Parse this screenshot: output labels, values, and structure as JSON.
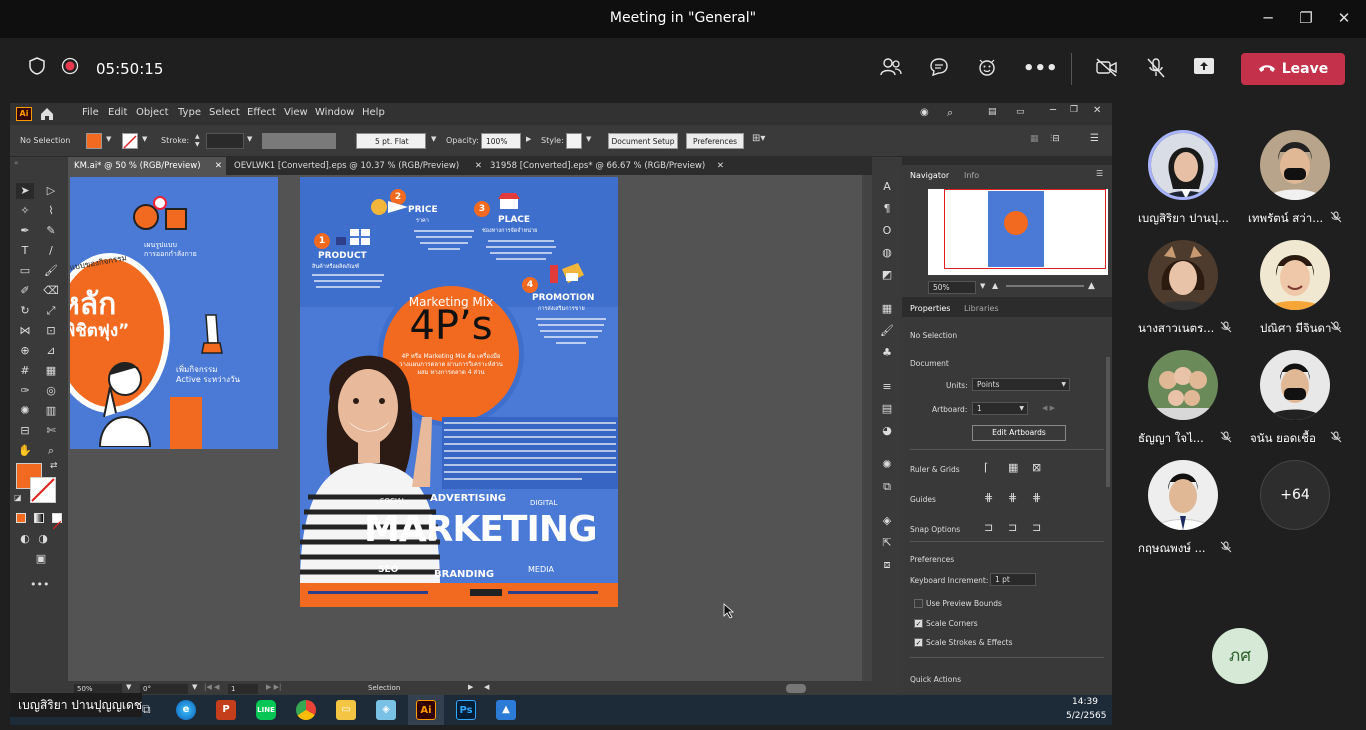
{
  "window": {
    "title": "Meeting in \"General\""
  },
  "meeting": {
    "timer": "05:50:15",
    "leave_label": "Leave"
  },
  "illustrator": {
    "menus": [
      "File",
      "Edit",
      "Object",
      "Type",
      "Select",
      "Effect",
      "View",
      "Window",
      "Help"
    ],
    "control": {
      "selection": "No Selection",
      "stroke_label": "Stroke:",
      "brush": "5 pt. Flat",
      "opacity_label": "Opacity:",
      "opacity_value": "100%",
      "style_label": "Style:",
      "doc_setup": "Document Setup",
      "preferences": "Preferences"
    },
    "tabs": [
      "KM.ai* @ 50 % (RGB/Preview)",
      "OEVLWK1 [Converted].eps @ 10.37 % (RGB/Preview)",
      "31958 [Converted].eps* @ 66.67 % (RGB/Preview)"
    ],
    "status": {
      "zoom": "50%",
      "rotate": "0°",
      "artboard": "1",
      "tool": "Selection"
    },
    "panel": {
      "navigator_tab": "Navigator",
      "info_tab": "Info",
      "nav_zoom": "50%",
      "properties_tab": "Properties",
      "libraries_tab": "Libraries",
      "no_selection": "No Selection",
      "document": "Document",
      "units_label": "Units:",
      "units_value": "Points",
      "artboard_label": "Artboard:",
      "artboard_value": "1",
      "edit_artboards": "Edit Artboards",
      "rulers_grids": "Ruler & Grids",
      "guides": "Guides",
      "snap_options": "Snap Options",
      "preferences": "Preferences",
      "keyboard_increment_label": "Keyboard Increment:",
      "keyboard_increment_value": "1 pt",
      "use_preview_bounds": "Use Preview Bounds",
      "scale_corners": "Scale Corners",
      "scale_strokes": "Scale Strokes & Effects",
      "quick_actions": "Quick Actions"
    }
  },
  "poster": {
    "title_top": "Marketing Mix",
    "title_big": "4P’s",
    "p1": "PRODUCT",
    "p2": "PRICE",
    "p3": "PLACE",
    "p4": "PROMOTION",
    "n1": "1",
    "n2": "2",
    "n3": "3",
    "n4": "4",
    "p2_sub": "ราคา",
    "p3_sub": "ช่องทางการจัดจำหน่าย",
    "p4_sub": "การส่งเสริมการขาย",
    "p1_sub": "สินค้าหรือผลิตภัณฑ์",
    "circle_text": "4P หรือ Marketing Mix คือ เครื่องมือวางแผนการตลาด ผ่านการวิเคราะห์ส่วนผสม ทางการตลาด 4 ส่วน",
    "advertising": "ADVERTISING",
    "social": "SOCIAL",
    "digital": "DIGITAL",
    "marketing": "MARKETING",
    "seo": "SEO",
    "branding": "BRANDING",
    "media": "MEDIA",
    "left_headline": "หลัก",
    "left_sub": "พิชิตฟุง”",
    "left_cycle": "รูปแบบของกิจกรรม",
    "left_active": "Active",
    "left_add": "เพิ่ม"
  },
  "taskbar": {
    "presenter": "เบญสิริยา ปานปุญญเดช",
    "time": "14:39",
    "date": "5/2/2565",
    "apps": [
      "Ai",
      "Ps"
    ]
  },
  "participants": [
    {
      "name": "เบญสิริยา ปานปุ...",
      "muted": false
    },
    {
      "name": "เทพรัตน์ สว่า...",
      "muted": true
    },
    {
      "name": "นางสาวเนตร...",
      "muted": true
    },
    {
      "name": "ปณิศา มีจินดา",
      "muted": true
    },
    {
      "name": "ธัญญา ใจไ...",
      "muted": true
    },
    {
      "name": "จนัน ยอดเชื้อ",
      "muted": true
    },
    {
      "name": "กฤษณพงษ์ ...",
      "muted": true
    }
  ],
  "overflow_count": "+64",
  "self_initials": "ภศ"
}
